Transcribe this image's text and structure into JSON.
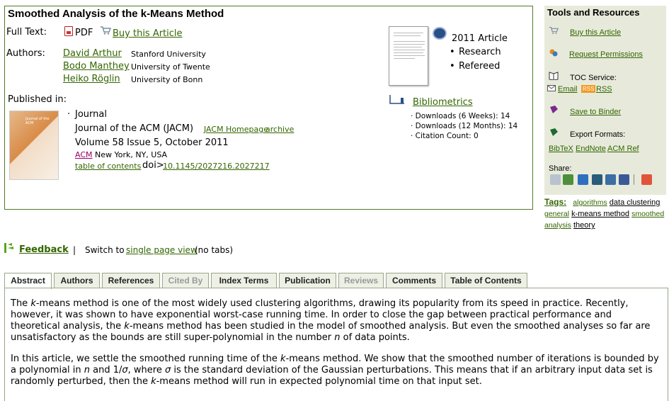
{
  "title": "Smoothed Analysis of the k-Means Method",
  "full_text": {
    "label": "Full Text:",
    "pdf_label": "PDF",
    "buy_label": "Buy this Article"
  },
  "authors": {
    "label": "Authors:",
    "list": [
      {
        "name": "David Arthur",
        "affiliation": "Stanford University"
      },
      {
        "name": "Bodo Manthey",
        "affiliation": "University of Twente"
      },
      {
        "name": "Heiko Röglin",
        "affiliation": "University of Bonn"
      }
    ]
  },
  "article_info": {
    "year_type": "2011 Article",
    "bullets": [
      "Research",
      "Refereed"
    ]
  },
  "bibliometrics": {
    "label": "Bibliometrics",
    "lines": [
      "· Downloads (6 Weeks): 14",
      "· Downloads (12 Months): 14",
      "· Citation Count: 0"
    ]
  },
  "published_in": {
    "label": "Published in:",
    "type": "Journal",
    "journal": "Journal of the ACM (JACM)",
    "homepage_link": "JACM Homepage",
    "archive_link": "archive",
    "volume": "Volume 58 Issue 5, October 2011",
    "publisher_link": "ACM",
    "publisher_location": "New York, NY, USA",
    "toc_link": "table of contents",
    "doi_label": "doi>",
    "doi_link": "10.1145/2027216.2027217",
    "cover_text": "Journal of the ACM"
  },
  "sidebar": {
    "title": "Tools and Resources",
    "buy": "Buy this Article",
    "permissions": "Request Permissions",
    "toc_service": "TOC Service:",
    "email": "Email",
    "rss_badge": "RSS",
    "rss": "RSS",
    "binder": "Save to Binder",
    "export": "Export Formats:",
    "formats": [
      "BibTeX",
      "EndNote",
      "ACM Ref"
    ],
    "share": "Share:"
  },
  "tags": {
    "label": "Tags:",
    "items": [
      "algorithms",
      "data clustering",
      "general",
      "k-means method",
      "smoothed analysis",
      "theory"
    ]
  },
  "feedback": {
    "link": "Feedback",
    "separator": "|",
    "switch_text": "Switch to",
    "single_page": "single page view",
    "no_tabs": "(no tabs)"
  },
  "tabs": [
    {
      "label": "Abstract",
      "state": "active"
    },
    {
      "label": "Authors",
      "state": "normal"
    },
    {
      "label": "References",
      "state": "normal"
    },
    {
      "label": "Cited By",
      "state": "disabled"
    },
    {
      "label": "Index Terms",
      "state": "normal"
    },
    {
      "label": "Publication",
      "state": "normal"
    },
    {
      "label": "Reviews",
      "state": "disabled"
    },
    {
      "label": "Comments",
      "state": "normal"
    },
    {
      "label": "Table of Contents",
      "state": "normal"
    }
  ],
  "abstract": {
    "p1": {
      "t1": "The ",
      "k": "k",
      "t2": "-means method is one of the most widely used clustering algorithms, drawing its popularity from its speed in practice. Recently, however, it was shown to have exponential worst-case running time. In order to close the gap between practical performance and theoretical analysis, the ",
      "t3": "-means method has been studied in the model of smoothed analysis. But even the smoothed analyses so far are unsatisfactory as the bounds are still super-polynomial in the number ",
      "n": "n",
      "t4": " of data points."
    },
    "p2": {
      "t1": "In this article, we settle the smoothed running time of the ",
      "k": "k",
      "t2": "-means method. We show that the smoothed number of iterations is bounded by a polynomial in ",
      "n": "n",
      "t3": " and 1/",
      "sigma": "σ",
      "t4": ", where ",
      "t5": " is the standard deviation of the Gaussian perturbations. This means that if an arbitrary input data set is randomly perturbed, then the ",
      "t6": "-means method will run in expected polynomial time on that input set."
    }
  },
  "colors": {
    "link": "#336600",
    "border": "#557a2a",
    "sidebar_bg": "#e7eadb",
    "tab_bg": "#eef0e6"
  }
}
